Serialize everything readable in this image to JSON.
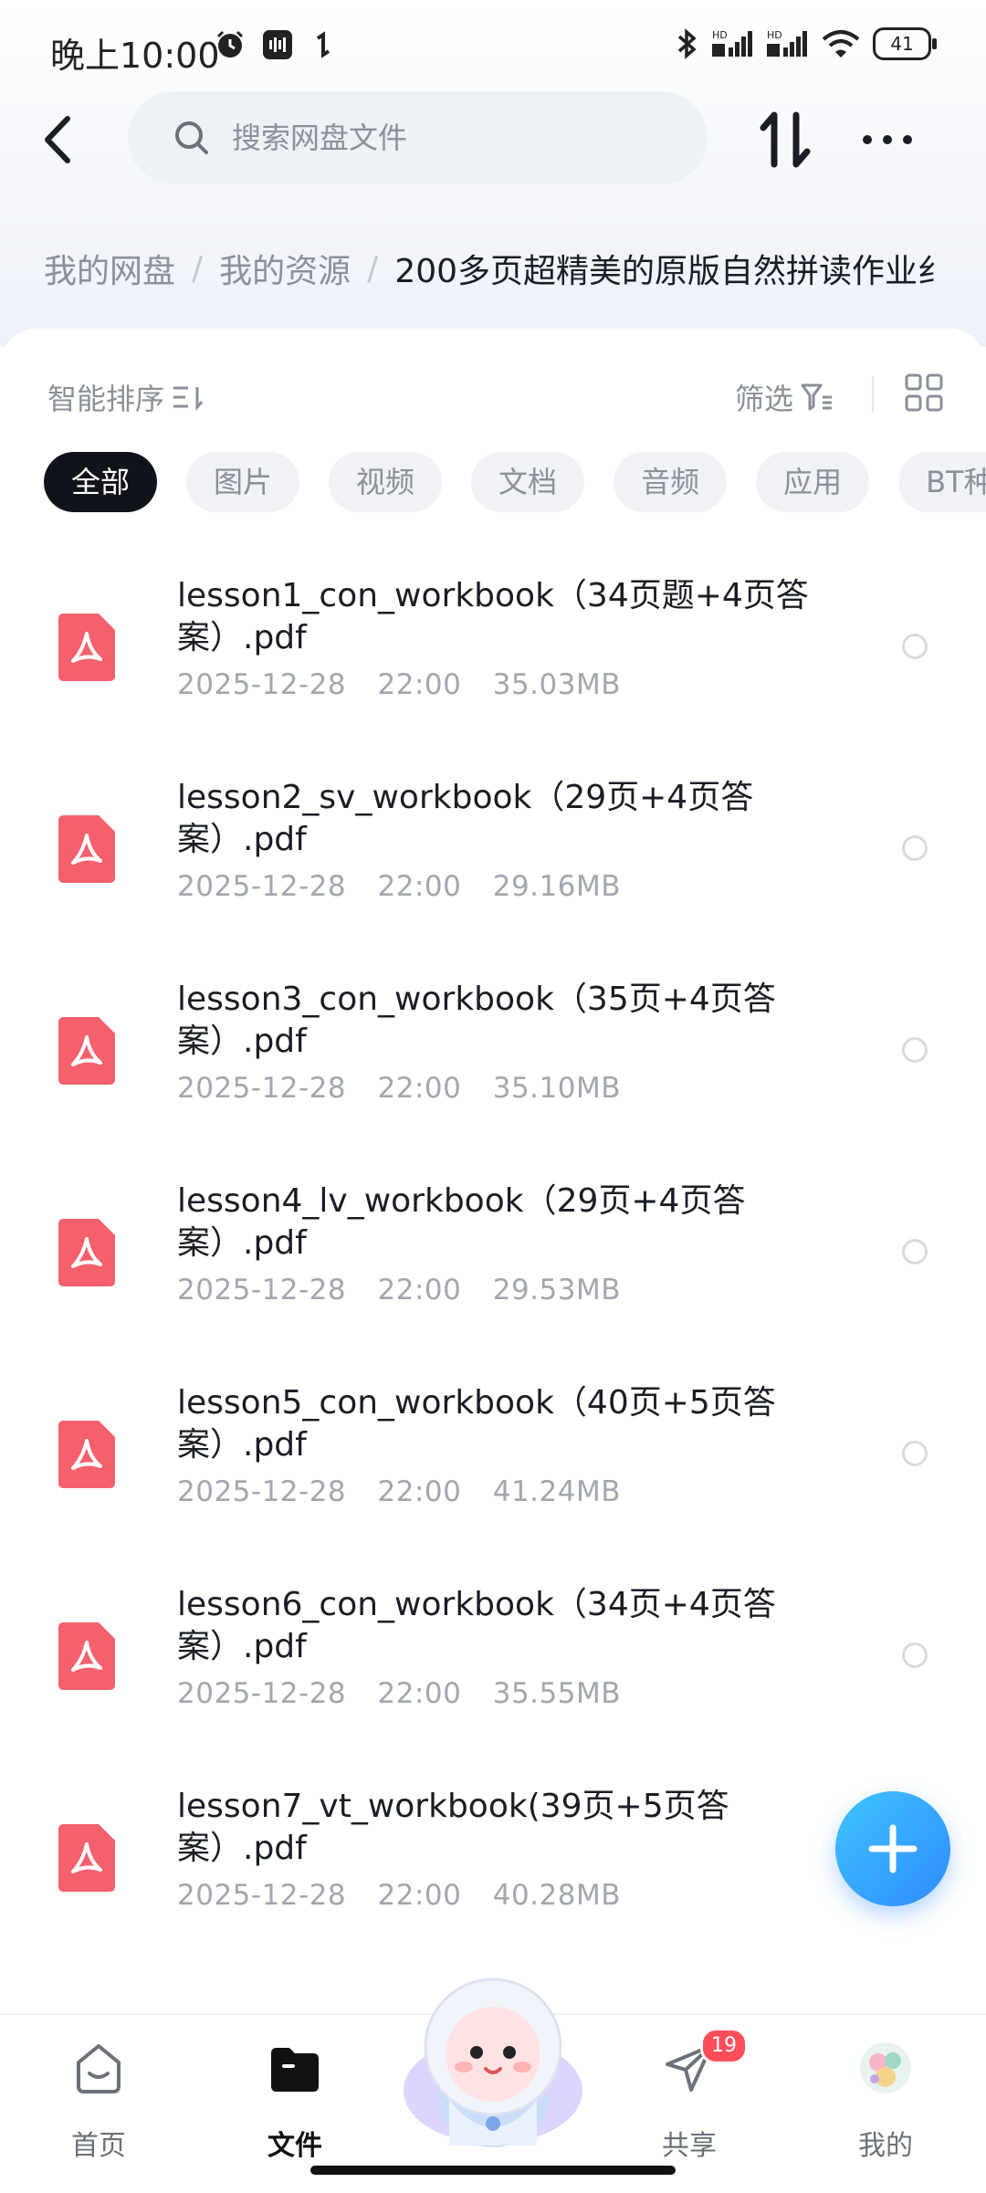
{
  "status_bar": {
    "time": "晚上10:00",
    "battery": "41"
  },
  "search": {
    "placeholder": "搜索网盘文件"
  },
  "breadcrumb": {
    "items": [
      "我的网盘",
      "我的资源"
    ],
    "current": "200多页超精美的原版自然拼读作业纟"
  },
  "toolbar": {
    "sort_label": "智能排序",
    "filter_label": "筛选"
  },
  "filter_chips": [
    "全部",
    "图片",
    "视频",
    "文档",
    "音频",
    "应用",
    "BT种子"
  ],
  "files": [
    {
      "name": "lesson1_con_workbook（34页题+4页答案）.pdf",
      "date": "2025-12-28",
      "time": "22:00",
      "size": "35.03MB"
    },
    {
      "name": "lesson2_sv_workbook（29页+4页答案）.pdf",
      "date": "2025-12-28",
      "time": "22:00",
      "size": "29.16MB"
    },
    {
      "name": "lesson3_con_workbook（35页+4页答案）.pdf",
      "date": "2025-12-28",
      "time": "22:00",
      "size": "35.10MB"
    },
    {
      "name": "lesson4_lv_workbook（29页+4页答案）.pdf",
      "date": "2025-12-28",
      "time": "22:00",
      "size": "29.53MB"
    },
    {
      "name": "lesson5_con_workbook（40页+5页答案）.pdf",
      "date": "2025-12-28",
      "time": "22:00",
      "size": "41.24MB"
    },
    {
      "name": "lesson6_con_workbook（34页+4页答案）.pdf",
      "date": "2025-12-28",
      "time": "22:00",
      "size": "35.55MB"
    },
    {
      "name": "lesson7_vt_workbook(39页+5页答案）.pdf",
      "date": "2025-12-28",
      "time": "22:00",
      "size": "40.28MB"
    }
  ],
  "bottom_nav": {
    "home": "首页",
    "files": "文件",
    "share": "共享",
    "share_badge": "19",
    "mine": "我的"
  },
  "colors": {
    "accent": "#2f8cff",
    "badge": "#ff4d5b",
    "pdf": "#f4606c"
  }
}
